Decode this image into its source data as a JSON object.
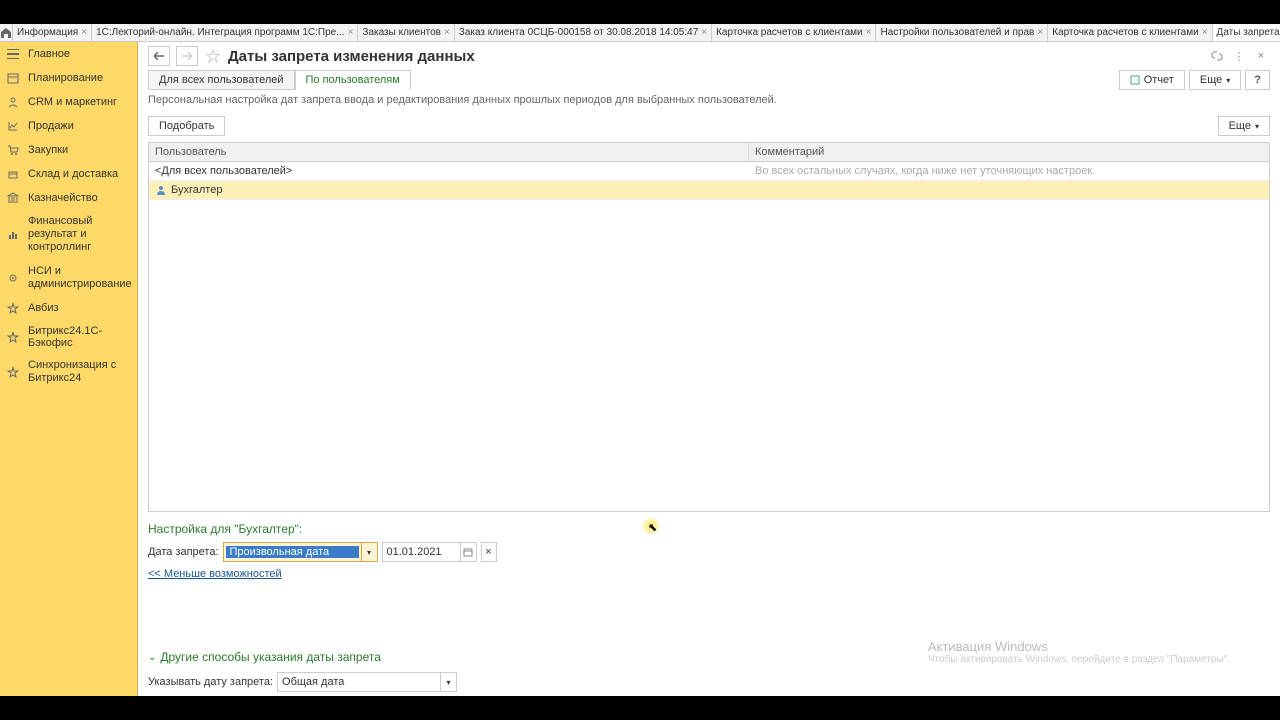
{
  "tabs": {
    "0": "Информация",
    "1": "1С:Лекторий-онлайн. Интеграция программ 1С:Пре...",
    "2": "Заказы клиентов",
    "3": "Заказ клиента 0СЦБ-000158 от 30.08.2018 14:05:47",
    "4": "Карточка расчетов с клиентами",
    "5": "Настройки пользователей и прав",
    "6": "Карточка расчетов с клиентами",
    "7": "Даты запрета изменения данных"
  },
  "sidebar": {
    "0": "Главное",
    "1": "Планирование",
    "2": "CRM и маркетинг",
    "3": "Продажи",
    "4": "Закупки",
    "5": "Склад и доставка",
    "6": "Казначейство",
    "7": "Финансовый результат и контроллинг",
    "8": "НСИ и администрирование",
    "9": "Авбиз",
    "10": "Битрикс24.1С-Бэкофис",
    "11": "Синхронизация с Битрикс24"
  },
  "header": {
    "title": "Даты запрета изменения данных",
    "report_btn": "Отчет",
    "more_btn": "Еще",
    "help_btn": "?"
  },
  "sub_tabs": {
    "0": "Для всех пользователей",
    "1": "По пользователям"
  },
  "description": "Персональная настройка дат запрета ввода и редактирования данных прошлых периодов для выбранных пользователей.",
  "toolbar": {
    "select_btn": "Подобрать",
    "more_btn": "Еще"
  },
  "table": {
    "col_user": "Пользователь",
    "col_comment": "Комментарий",
    "rows": {
      "0": {
        "user": "<Для всех пользователей>",
        "comment": "Во всех остальных случаях, когда ниже нет уточняющих настроек."
      },
      "1": {
        "user": "Бухгалтер",
        "comment": ""
      }
    }
  },
  "settings": {
    "title": "Настройка для \"Бухгалтер\":",
    "date_label": "Дата запрета:",
    "type_value": "Произвольная дата",
    "date_value": "01.01.2021",
    "less_link": "<< Меньше возможностей"
  },
  "collapsible": {
    "title": "Другие способы указания даты запрета"
  },
  "bottom_form": {
    "label": "Указывать дату запрета:",
    "value": "Общая дата"
  },
  "watermark": {
    "title": "Активация Windows",
    "sub": "Чтобы активировать Windows, перейдите в раздел \"Параметры\"."
  }
}
